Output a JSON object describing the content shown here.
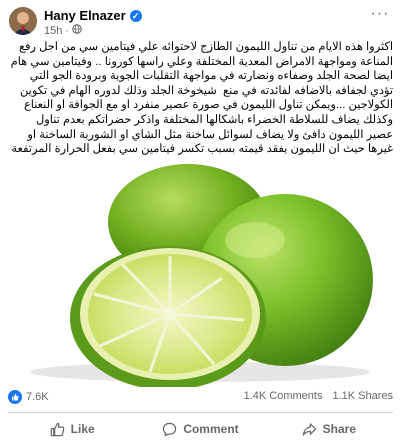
{
  "post": {
    "author": "Hany Elnazer",
    "time": "15h",
    "dot": "·",
    "text": "اكثروا هذه الايام من تناول الليمون الطازج لاحتوائه علي فيتامين سي من اجل رفع المناعة ومواجهة الامراض المعدية المختلفة وعلي راسها كورونا .. وفيتامين سي هام ايضا لصحة الجلد وصفاءه ونضارته في مواجهة التقلبات الجوية وبرودة الجو التي تؤدي لجفافه بالاضافه لفائدته في منع  شيخوخة الجلد وذلك لدوره الهام في تكوين الكولاجين ...ويمكن تناول الليمون في صورة عصير منفرد او مع الجوافة او النعناع وكذلك يضاف للسلاطة الخضراء باشكالها المختلفة واذكر حضراتكم بعدم تناول عصير الليمون دافئ ولا يضاف لسوائل ساخنة مثل الشاي او الشوربة الساخنة او غيرها حيث ان الليمون يفقد قيمته بسبب تكسر فيتامين سي بفعل الحرارة المرتفعة"
  },
  "stats": {
    "reactions": "7.6K",
    "comments": "1.4K Comments",
    "shares": "1.1K Shares"
  },
  "actions": {
    "like": "Like",
    "comment": "Comment",
    "share": "Share"
  },
  "colors": {
    "facebook_blue": "#1877f2",
    "secondary_text": "#65676b",
    "lime_green": "#6fae1e"
  }
}
